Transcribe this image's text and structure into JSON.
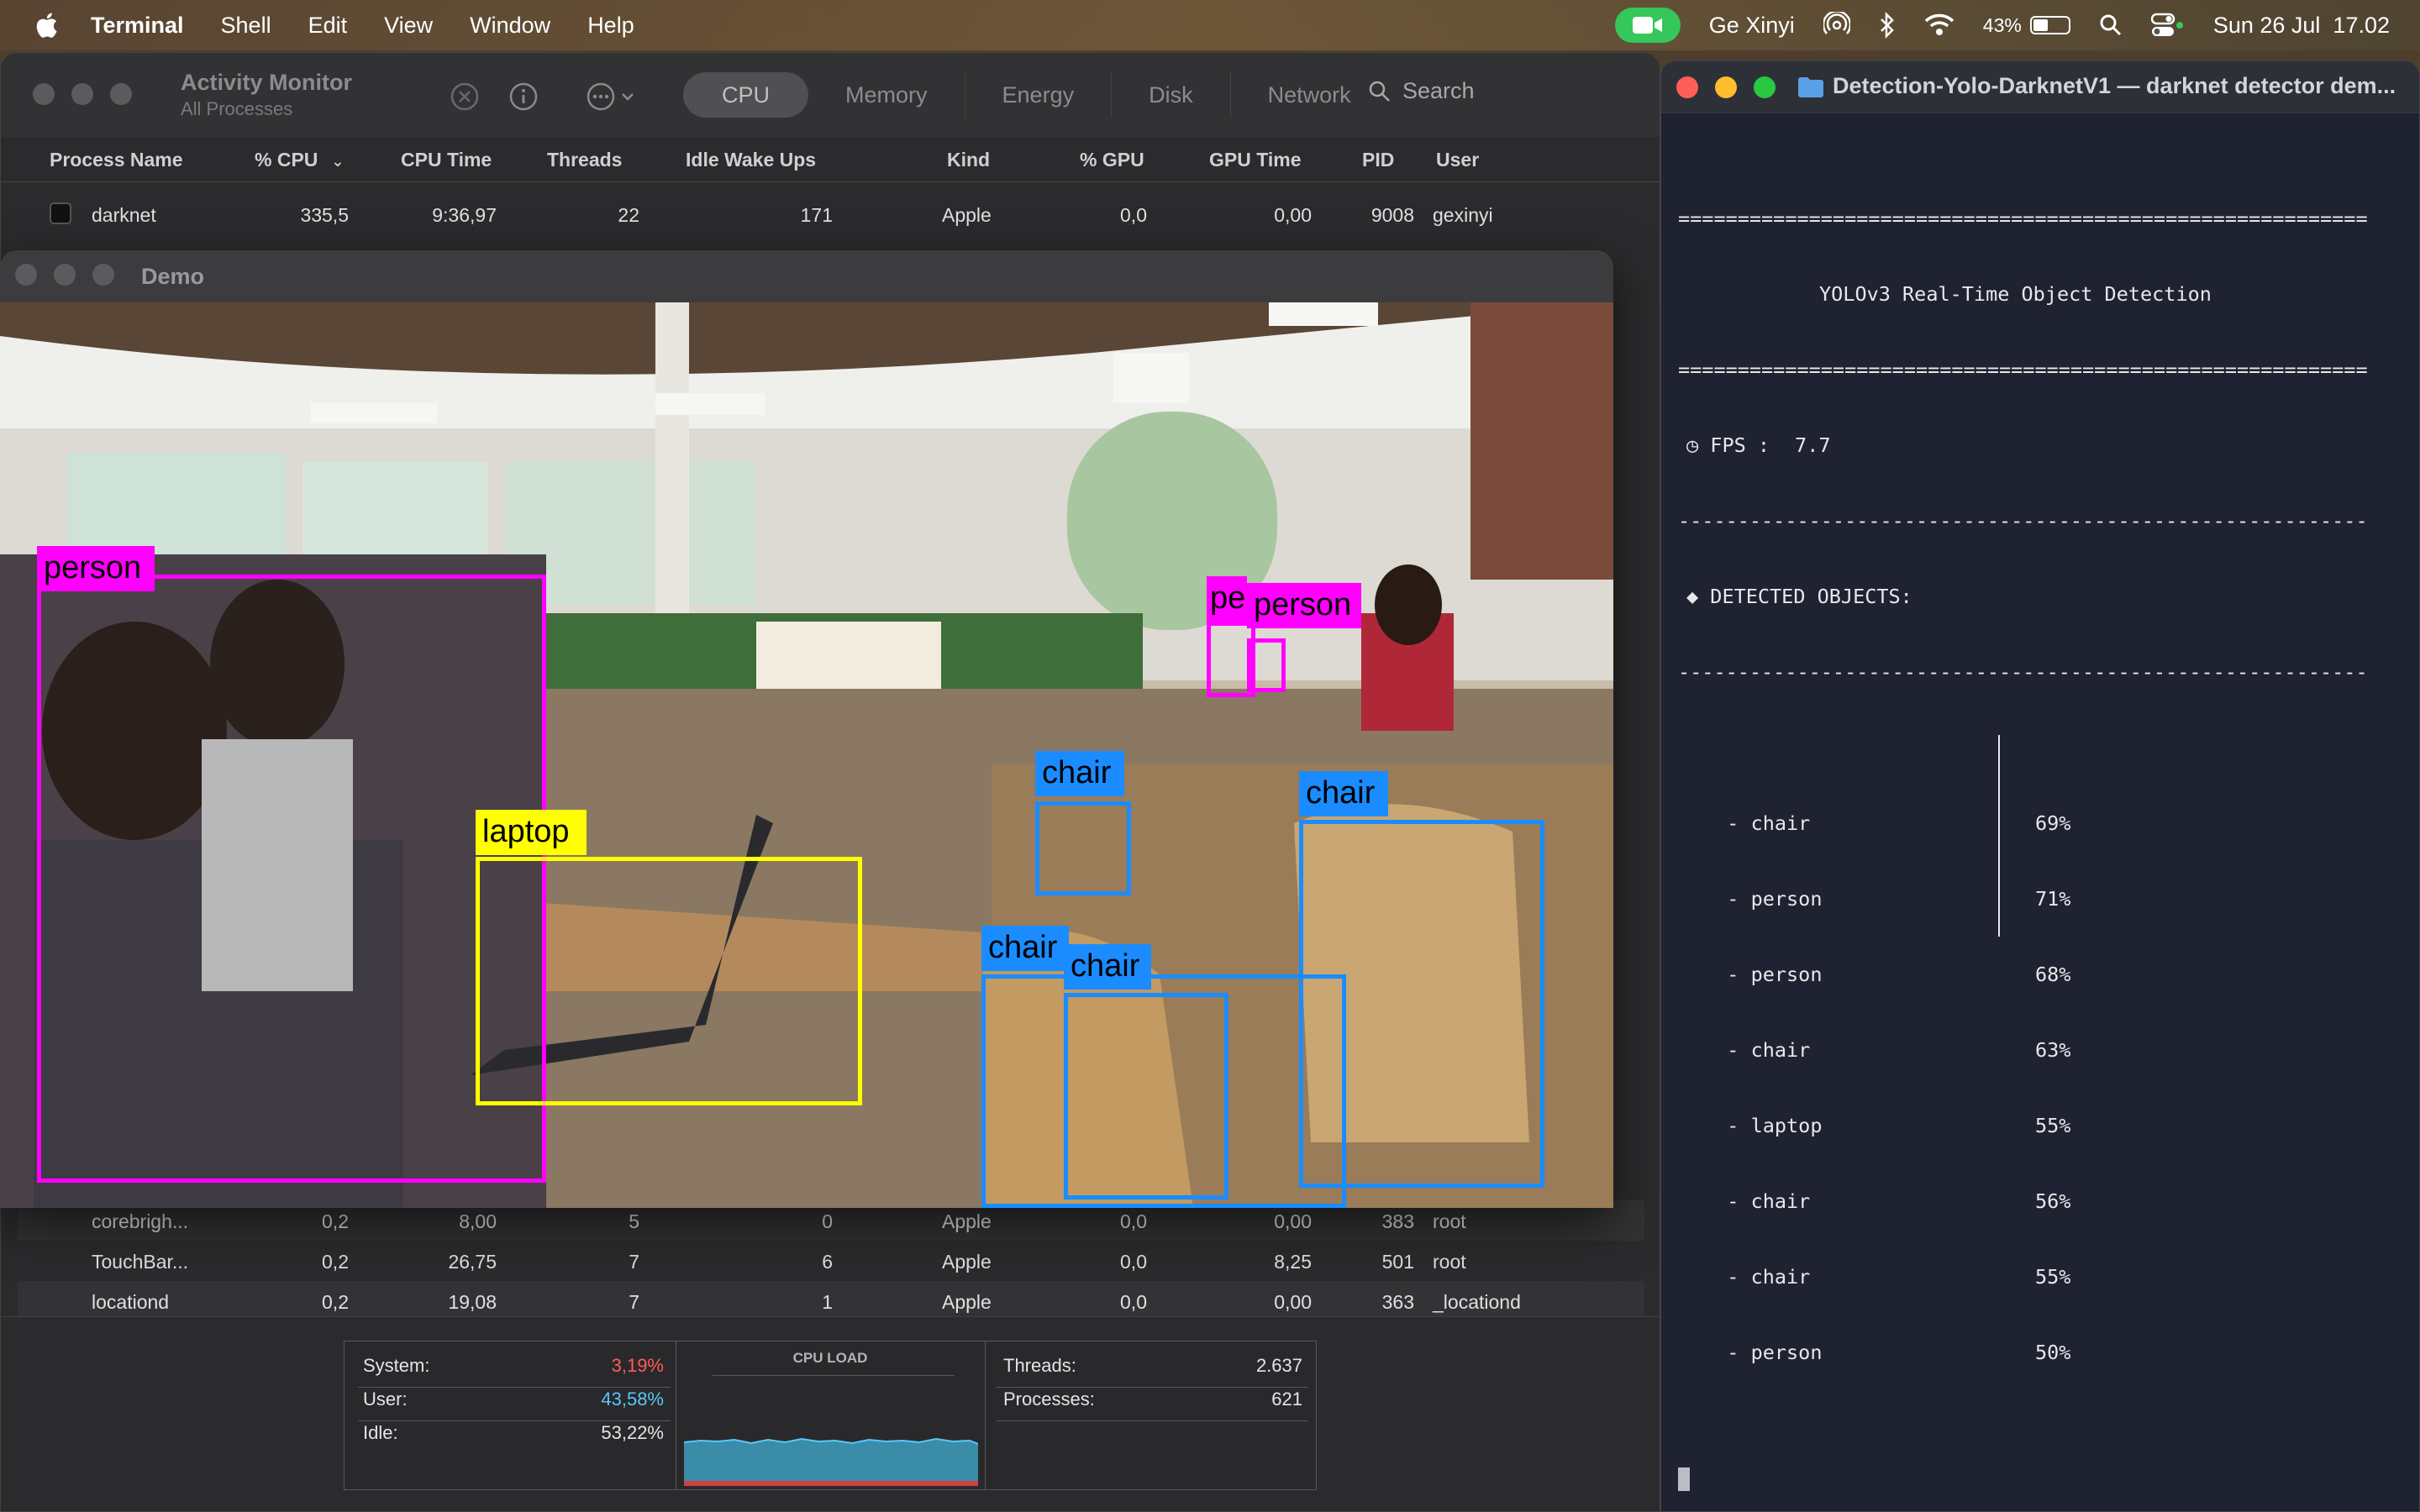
{
  "menubar": {
    "app_name": "Terminal",
    "menus": [
      "Shell",
      "Edit",
      "View",
      "Window",
      "Help"
    ],
    "user": "Ge Xinyi",
    "battery_percent": "43%",
    "battery_level": 0.43,
    "datetime": "Sun 26 Jul  17.02"
  },
  "activity_monitor": {
    "title": "Activity Monitor",
    "subtitle": "All Processes",
    "tabs": [
      "CPU",
      "Memory",
      "Energy",
      "Disk",
      "Network"
    ],
    "active_tab": "CPU",
    "search_label": "Search",
    "columns": [
      "Process Name",
      "% CPU",
      "CPU Time",
      "Threads",
      "Idle Wake Ups",
      "Kind",
      "% GPU",
      "GPU Time",
      "PID",
      "User"
    ],
    "rows_top": [
      {
        "name": "darknet",
        "cpu": "335,5",
        "cpu_time": "9:36,97",
        "threads": "22",
        "idle": "171",
        "kind": "Apple",
        "gpu": "0,0",
        "gpu_time": "0,00",
        "pid": "9008",
        "user": "gexinyi"
      }
    ],
    "rows_bottom": [
      {
        "name": "corebrigh...",
        "cpu": "0,2",
        "cpu_time": "8,00",
        "threads": "5",
        "idle": "0",
        "kind": "Apple",
        "gpu": "0,0",
        "gpu_time": "0,00",
        "pid": "383",
        "user": "root"
      },
      {
        "name": "TouchBar...",
        "cpu": "0,2",
        "cpu_time": "26,75",
        "threads": "7",
        "idle": "6",
        "kind": "Apple",
        "gpu": "0,0",
        "gpu_time": "8,25",
        "pid": "501",
        "user": "root"
      },
      {
        "name": "locationd",
        "cpu": "0,2",
        "cpu_time": "19,08",
        "threads": "7",
        "idle": "1",
        "kind": "Apple",
        "gpu": "0,0",
        "gpu_time": "0,00",
        "pid": "363",
        "user": "_locationd"
      }
    ],
    "footer": {
      "system_label": "System:",
      "system_value": "3,19%",
      "user_label": "User:",
      "user_value": "43,58%",
      "idle_label": "Idle:",
      "idle_value": "53,22%",
      "cpu_load_title": "CPU LOAD",
      "threads_label": "Threads:",
      "threads_value": "2.637",
      "processes_label": "Processes:",
      "processes_value": "621",
      "colors": {
        "system": "#ff5c5c",
        "user": "#5ac8fa"
      }
    }
  },
  "demo_window": {
    "title": "Demo",
    "detections": [
      {
        "label": "person",
        "color": "#ff00ff"
      },
      {
        "label": "laptop",
        "color": "#ffff00"
      },
      {
        "label": "pe",
        "color": "#ff00ff"
      },
      {
        "label": "person",
        "color": "#ff00ff"
      },
      {
        "label": "chair",
        "color": "#1a8cff"
      },
      {
        "label": "chair",
        "color": "#1a8cff"
      },
      {
        "label": "chair",
        "color": "#1a8cff"
      },
      {
        "label": "chair",
        "color": "#1a8cff"
      }
    ]
  },
  "terminal": {
    "title": "Detection-Yolo-DarknetV1 — darknet detector dem...",
    "separator_eq": "==========================================================",
    "separator_dash": "----------------------------------------------------------",
    "heading": "YOLOv3 Real-Time Object Detection",
    "fps_label": "◷ FPS :",
    "fps_value": "7.7",
    "detected_heading": "◆ DETECTED OBJECTS:",
    "objects": [
      {
        "name": "  - chair",
        "pct": "69%"
      },
      {
        "name": "  - person",
        "pct": "71%"
      },
      {
        "name": "  - person",
        "pct": "68%"
      },
      {
        "name": "  - chair",
        "pct": "63%"
      },
      {
        "name": "  - laptop",
        "pct": "55%"
      },
      {
        "name": "  - chair",
        "pct": "56%"
      },
      {
        "name": "  - chair",
        "pct": "55%"
      },
      {
        "name": "  - person",
        "pct": "50%"
      }
    ]
  }
}
